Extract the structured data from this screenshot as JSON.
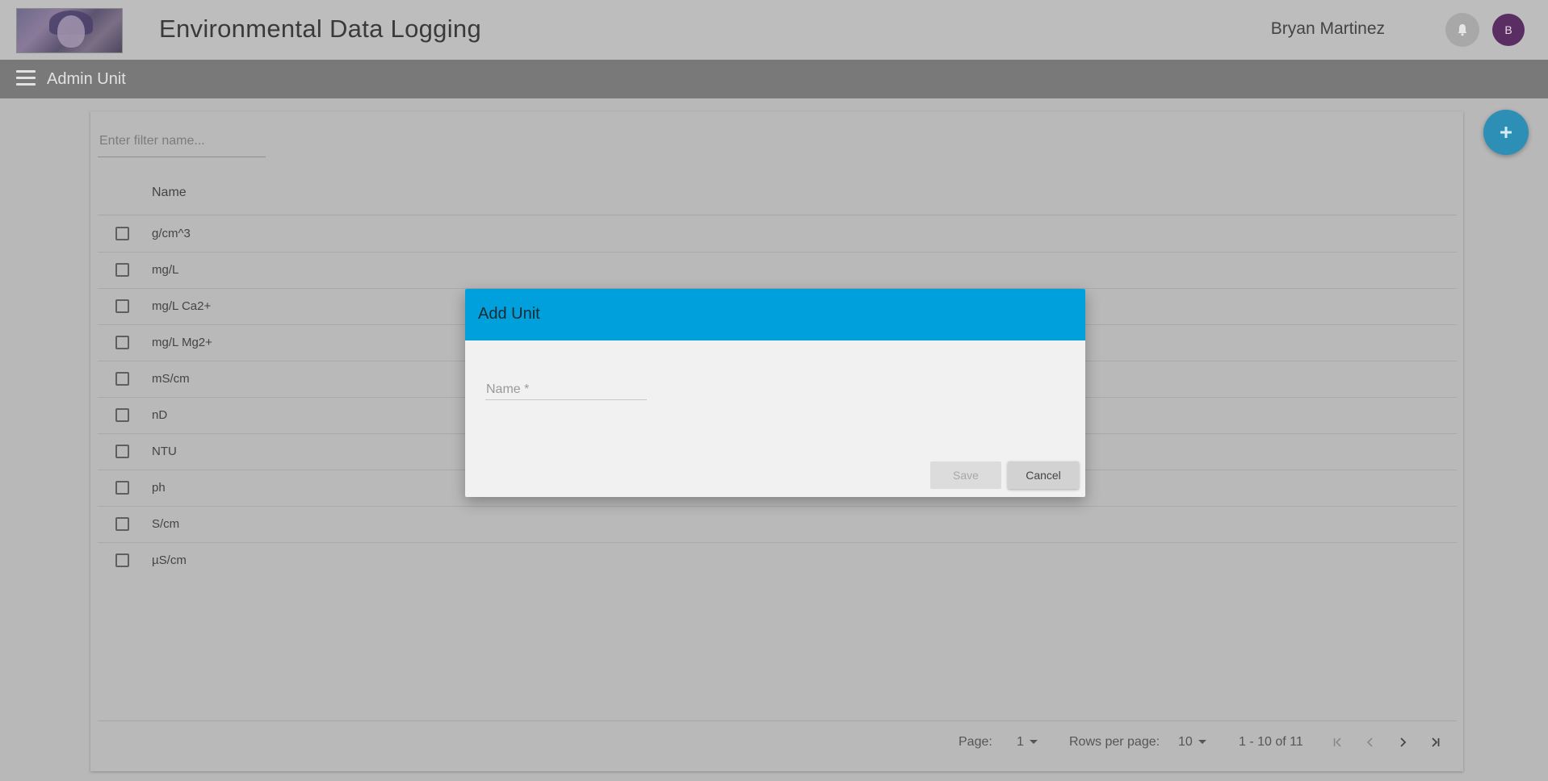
{
  "header": {
    "app_title": "Environmental Data Logging",
    "user_name": "Bryan Martinez",
    "avatar_initial": "B"
  },
  "subnav": {
    "title": "Admin Unit"
  },
  "table": {
    "filter_placeholder": "Enter filter name...",
    "column_name": "Name",
    "rows": [
      "g/cm^3",
      "mg/L",
      "mg/L Ca2+",
      "mg/L Mg2+",
      "mS/cm",
      "nD",
      "NTU",
      "ph",
      "S/cm",
      "µS/cm"
    ]
  },
  "pagination": {
    "page_label": "Page:",
    "page_value": "1",
    "rows_label": "Rows per page:",
    "rows_value": "10",
    "range_text": "1 - 10 of 11"
  },
  "dialog": {
    "title": "Add Unit",
    "name_label": "Name *",
    "save_label": "Save",
    "cancel_label": "Cancel"
  },
  "colors": {
    "dialog_header": "#00a0dc",
    "fab": "#2d8fb6",
    "avatar": "#5a2e62"
  },
  "icons": {
    "bell": "bell-icon",
    "menu": "menu-icon",
    "add": "plus-icon",
    "first": "first-page-icon",
    "prev": "chevron-left-icon",
    "next": "chevron-right-icon",
    "last": "last-page-icon"
  }
}
